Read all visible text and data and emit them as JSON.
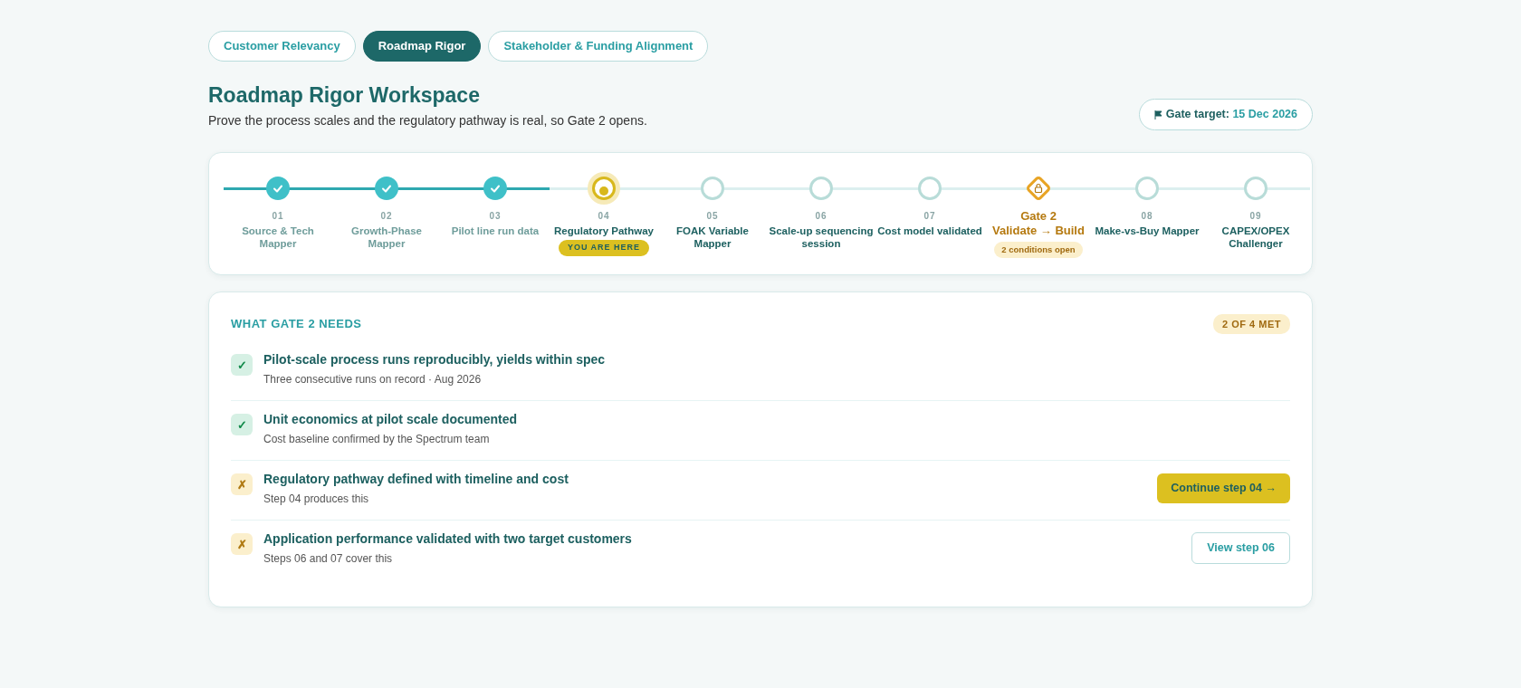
{
  "tabs": [
    {
      "label": "Customer Relevancy",
      "selected": false
    },
    {
      "label": "Roadmap Rigor",
      "selected": true
    },
    {
      "label": "Stakeholder & Funding Alignment",
      "selected": false
    }
  ],
  "header": {
    "title": "Roadmap Rigor Workspace",
    "subtitle": "Prove the process scales and the regulatory pathway is real, so Gate 2 opens.",
    "gate_target_label": "Gate target:",
    "gate_target_date": "15 Dec 2026"
  },
  "steps": [
    {
      "kind": "step",
      "done": true,
      "selected": false,
      "number": "01",
      "label": "Source & Tech Mapper"
    },
    {
      "kind": "step",
      "done": true,
      "selected": false,
      "number": "02",
      "label": "Growth-Phase Mapper"
    },
    {
      "kind": "step",
      "done": true,
      "selected": false,
      "number": "03",
      "label": "Pilot line run data"
    },
    {
      "kind": "step",
      "done": false,
      "selected": true,
      "number": "04",
      "label": "Regulatory Pathway",
      "badge": "YOU ARE HERE"
    },
    {
      "kind": "step",
      "done": false,
      "selected": false,
      "number": "05",
      "label": "FOAK Variable Mapper"
    },
    {
      "kind": "step",
      "done": false,
      "selected": false,
      "number": "06",
      "label": "Scale-up sequencing session"
    },
    {
      "kind": "step",
      "done": false,
      "selected": false,
      "number": "07",
      "label": "Cost model validated"
    },
    {
      "kind": "gate",
      "locked": true,
      "title": "Gate 2",
      "label": "Validate → Build",
      "badge": "2 conditions open"
    },
    {
      "kind": "step",
      "done": false,
      "selected": false,
      "number": "08",
      "label": "Make-vs-Buy Mapper"
    },
    {
      "kind": "step",
      "done": false,
      "selected": false,
      "number": "09",
      "label": "CAPEX/OPEX Challenger"
    }
  ],
  "gate_needs": {
    "title": "WHAT GATE 2 NEEDS",
    "count_badge": "2 OF 4 MET",
    "items": [
      {
        "met": true,
        "mark": "✓",
        "title": "Pilot-scale process runs reproducibly, yields within spec",
        "detail": "Three consecutive runs on record · Aug 2026"
      },
      {
        "met": true,
        "mark": "✓",
        "title": "Unit economics at pilot scale documented",
        "detail": "Cost baseline confirmed by the Spectrum team"
      },
      {
        "met": false,
        "mark": "✗",
        "title": "Regulatory pathway defined with timeline and cost",
        "detail": "Step 04 produces this",
        "action": {
          "kind": "primary",
          "label": "Continue step 04 →"
        }
      },
      {
        "met": false,
        "mark": "✗",
        "title": "Application performance validated with two target customers",
        "detail": "Steps 06 and 07 cover this",
        "action": {
          "kind": "outline",
          "label": "View step 06"
        }
      }
    ]
  }
}
